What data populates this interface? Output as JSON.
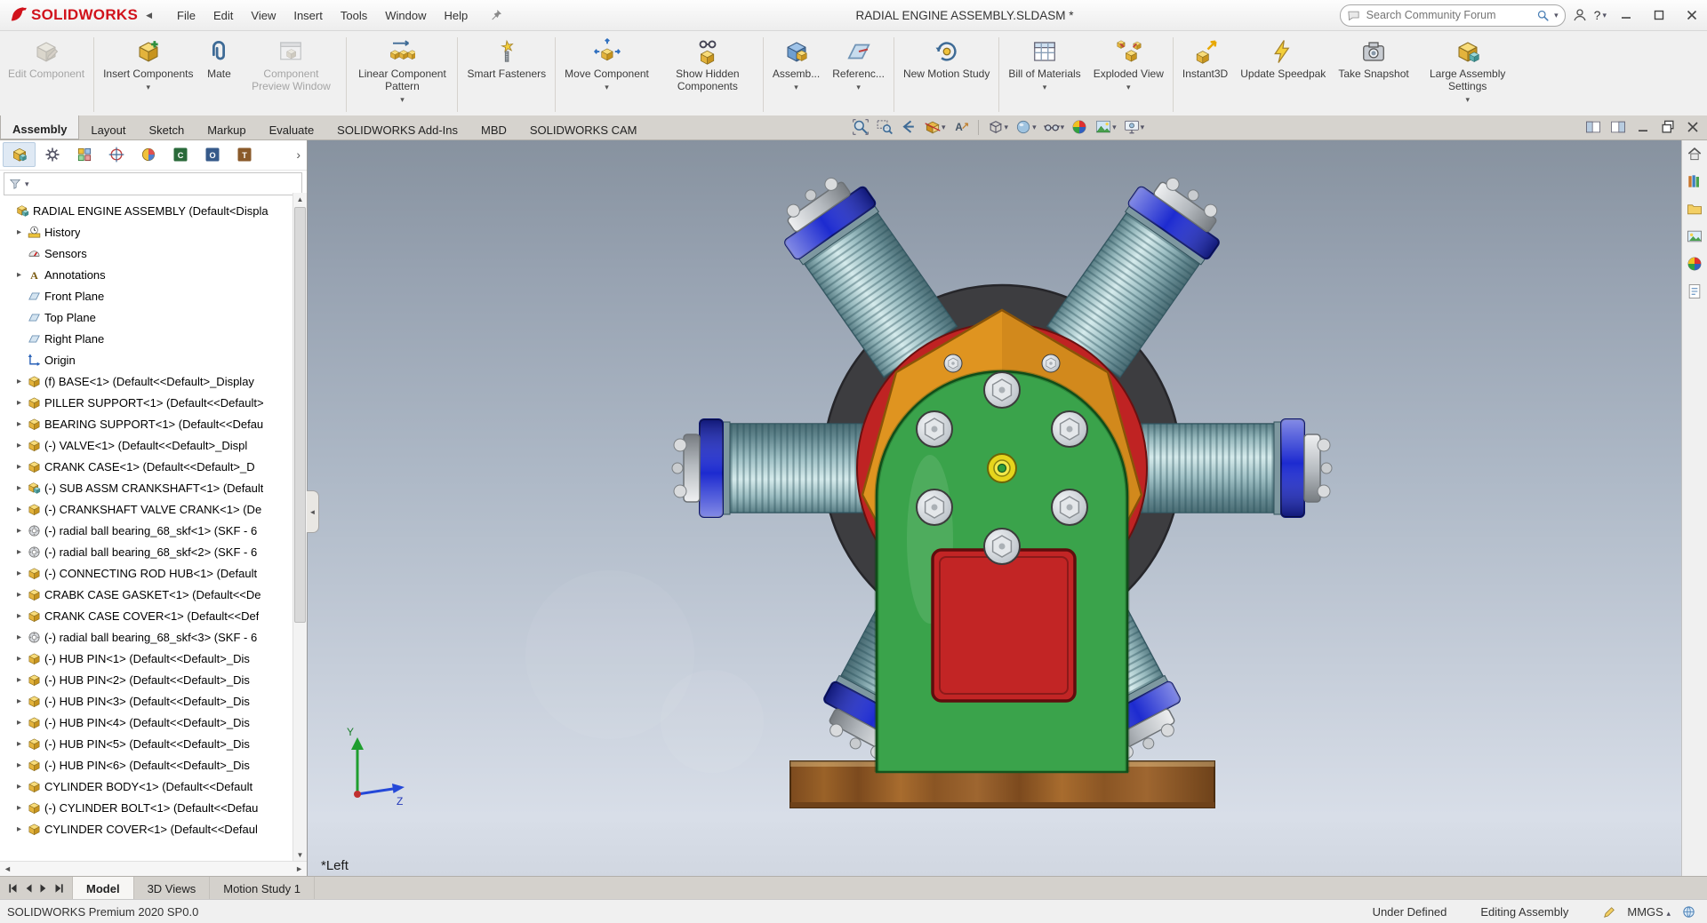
{
  "colors": {
    "brand-red": "#d1121b",
    "crank-green": "#3aa34b",
    "case-red": "#bf2323",
    "cover-red": "#c22525",
    "band-blue": "#1d2bd0",
    "plate-orange": "#df9420",
    "base-brown": "#6e421a",
    "hub-yellow": "#e6d51c",
    "ring-gray": "#3d3d40"
  },
  "titlebar": {
    "logo_text": "SOLIDWORKS",
    "menu": [
      "File",
      "Edit",
      "View",
      "Insert",
      "Tools",
      "Window",
      "Help"
    ],
    "document_title": "RADIAL ENGINE ASSEMBLY.SLDASM *",
    "search_placeholder": "Search Community Forum",
    "help_label": "?"
  },
  "ribbon": {
    "buttons": [
      {
        "label": "Edit Component",
        "icon": "edit-component",
        "enabled": false,
        "dropdown": false
      },
      {
        "label": "Insert Components",
        "icon": "insert-components",
        "enabled": true,
        "dropdown": true
      },
      {
        "label": "Mate",
        "icon": "mate",
        "enabled": true,
        "dropdown": false
      },
      {
        "label": "Component Preview Window",
        "icon": "component-preview-window",
        "enabled": false,
        "dropdown": false
      },
      {
        "label": "Linear Component Pattern",
        "icon": "linear-component-pattern",
        "enabled": true,
        "dropdown": true
      },
      {
        "label": "Smart Fasteners",
        "icon": "smart-fasteners",
        "enabled": true,
        "dropdown": false
      },
      {
        "label": "Move Component",
        "icon": "move-component",
        "enabled": true,
        "dropdown": true
      },
      {
        "label": "Show Hidden Components",
        "icon": "show-hidden-components",
        "enabled": true,
        "dropdown": false
      },
      {
        "label": "Assemb...",
        "icon": "assembly-features",
        "enabled": true,
        "dropdown": true
      },
      {
        "label": "Referenc...",
        "icon": "reference-geometry",
        "enabled": true,
        "dropdown": true
      },
      {
        "label": "New Motion Study",
        "icon": "new-motion-study",
        "enabled": true,
        "dropdown": false
      },
      {
        "label": "Bill of Materials",
        "icon": "bill-of-materials",
        "enabled": true,
        "dropdown": true
      },
      {
        "label": "Exploded View",
        "icon": "exploded-view",
        "enabled": true,
        "dropdown": true
      },
      {
        "label": "Instant3D",
        "icon": "instant3d",
        "enabled": true,
        "dropdown": false
      },
      {
        "label": "Update Speedpak",
        "icon": "update-speedpak",
        "enabled": true,
        "dropdown": false
      },
      {
        "label": "Take Snapshot",
        "icon": "take-snapshot",
        "enabled": true,
        "dropdown": false
      },
      {
        "label": "Large Assembly Settings",
        "icon": "large-assembly-settings",
        "enabled": true,
        "dropdown": true
      }
    ],
    "tabs": [
      {
        "label": "Assembly",
        "active": true
      },
      {
        "label": "Layout",
        "active": false
      },
      {
        "label": "Sketch",
        "active": false
      },
      {
        "label": "Markup",
        "active": false
      },
      {
        "label": "Evaluate",
        "active": false
      },
      {
        "label": "SOLIDWORKS Add-Ins",
        "active": false
      },
      {
        "label": "MBD",
        "active": false
      },
      {
        "label": "SOLIDWORKS CAM",
        "active": false
      }
    ],
    "headsup": [
      {
        "name": "zoom-fit",
        "dropdown": false
      },
      {
        "name": "zoom-area",
        "dropdown": false
      },
      {
        "name": "previous-view",
        "dropdown": false
      },
      {
        "name": "section-view",
        "dropdown": true
      },
      {
        "name": "dynamic-annotation",
        "dropdown": false
      },
      {
        "name": "view-orientation",
        "dropdown": true
      },
      {
        "name": "display-style",
        "dropdown": true
      },
      {
        "name": "hide-show-items",
        "dropdown": true
      },
      {
        "name": "edit-appearance",
        "dropdown": false
      },
      {
        "name": "apply-scene",
        "dropdown": true
      },
      {
        "name": "view-settings",
        "dropdown": true
      }
    ],
    "window_icons": [
      "pane-left",
      "pane-right",
      "doc-minimize",
      "doc-restore",
      "doc-close"
    ]
  },
  "panel": {
    "tabs": [
      "featuremanager",
      "propertymanager",
      "configurationmanager",
      "dimxpertmanager",
      "displaymanager",
      "cam-feature-tree",
      "cam-operation-tree",
      "cam-tools-tree"
    ],
    "tree": [
      {
        "label": "RADIAL ENGINE ASSEMBLY  (Default<Displa",
        "icon": "assembly",
        "arrow": false,
        "depth": 0
      },
      {
        "label": "History",
        "icon": "history",
        "arrow": true,
        "depth": 1
      },
      {
        "label": "Sensors",
        "icon": "sensors",
        "arrow": false,
        "depth": 1
      },
      {
        "label": "Annotations",
        "icon": "annotations",
        "arrow": true,
        "depth": 1
      },
      {
        "label": "Front Plane",
        "icon": "plane",
        "arrow": false,
        "depth": 1
      },
      {
        "label": "Top Plane",
        "icon": "plane",
        "arrow": false,
        "depth": 1
      },
      {
        "label": "Right Plane",
        "icon": "plane",
        "arrow": false,
        "depth": 1
      },
      {
        "label": "Origin",
        "icon": "origin",
        "arrow": false,
        "depth": 1
      },
      {
        "label": "(f) BASE<1> (Default<<Default>_Display",
        "icon": "part",
        "arrow": true,
        "depth": 1
      },
      {
        "label": "PILLER SUPPORT<1> (Default<<Default>",
        "icon": "part",
        "arrow": true,
        "depth": 1
      },
      {
        "label": "BEARING SUPPORT<1> (Default<<Defau",
        "icon": "part",
        "arrow": true,
        "depth": 1
      },
      {
        "label": "(-) VALVE<1> (Default<<Default>_Displ",
        "icon": "part",
        "arrow": true,
        "depth": 1
      },
      {
        "label": "CRANK CASE<1> (Default<<Default>_D",
        "icon": "part",
        "arrow": true,
        "depth": 1
      },
      {
        "label": "(-) SUB ASSM CRANKSHAFT<1> (Default",
        "icon": "assembly",
        "arrow": true,
        "depth": 1
      },
      {
        "label": "(-) CRANKSHAFT VALVE CRANK<1> (De",
        "icon": "part",
        "arrow": true,
        "depth": 1
      },
      {
        "label": "(-) radial ball bearing_68_skf<1> (SKF - 6",
        "icon": "bearing",
        "arrow": true,
        "depth": 1
      },
      {
        "label": "(-) radial ball bearing_68_skf<2> (SKF - 6",
        "icon": "bearing",
        "arrow": true,
        "depth": 1
      },
      {
        "label": "(-) CONNECTING ROD HUB<1> (Default",
        "icon": "part",
        "arrow": true,
        "depth": 1
      },
      {
        "label": "CRABK CASE GASKET<1> (Default<<De",
        "icon": "part",
        "arrow": true,
        "depth": 1
      },
      {
        "label": "CRANK CASE COVER<1> (Default<<Def",
        "icon": "part",
        "arrow": true,
        "depth": 1
      },
      {
        "label": "(-) radial ball bearing_68_skf<3> (SKF - 6",
        "icon": "bearing",
        "arrow": true,
        "depth": 1
      },
      {
        "label": "(-) HUB PIN<1> (Default<<Default>_Dis",
        "icon": "part",
        "arrow": true,
        "depth": 1
      },
      {
        "label": "(-) HUB PIN<2> (Default<<Default>_Dis",
        "icon": "part",
        "arrow": true,
        "depth": 1
      },
      {
        "label": "(-) HUB PIN<3> (Default<<Default>_Dis",
        "icon": "part",
        "arrow": true,
        "depth": 1
      },
      {
        "label": "(-) HUB PIN<4> (Default<<Default>_Dis",
        "icon": "part",
        "arrow": true,
        "depth": 1
      },
      {
        "label": "(-) HUB PIN<5> (Default<<Default>_Dis",
        "icon": "part",
        "arrow": true,
        "depth": 1
      },
      {
        "label": "(-) HUB PIN<6> (Default<<Default>_Dis",
        "icon": "part",
        "arrow": true,
        "depth": 1
      },
      {
        "label": "CYLINDER BODY<1> (Default<<Default",
        "icon": "part",
        "arrow": true,
        "depth": 1
      },
      {
        "label": "(-) CYLINDER BOLT<1> (Default<<Defau",
        "icon": "part",
        "arrow": true,
        "depth": 1
      },
      {
        "label": "CYLINDER COVER<1> (Default<<Defaul",
        "icon": "part",
        "arrow": true,
        "depth": 1
      }
    ]
  },
  "viewport": {
    "view_label": "*Left",
    "triad": {
      "y_label": "Y",
      "z_label": "Z"
    }
  },
  "taskpane": [
    "home",
    "design-library",
    "file-explorer",
    "view-palette",
    "appearances",
    "custom-properties"
  ],
  "bottombar": {
    "tabs": [
      {
        "label": "Model",
        "active": true
      },
      {
        "label": "3D Views",
        "active": false
      },
      {
        "label": "Motion Study 1",
        "active": false
      }
    ]
  },
  "statusbar": {
    "left": "SOLIDWORKS Premium 2020 SP0.0",
    "constraint_status": "Under Defined",
    "mode": "Editing Assembly",
    "units": "MMGS"
  }
}
